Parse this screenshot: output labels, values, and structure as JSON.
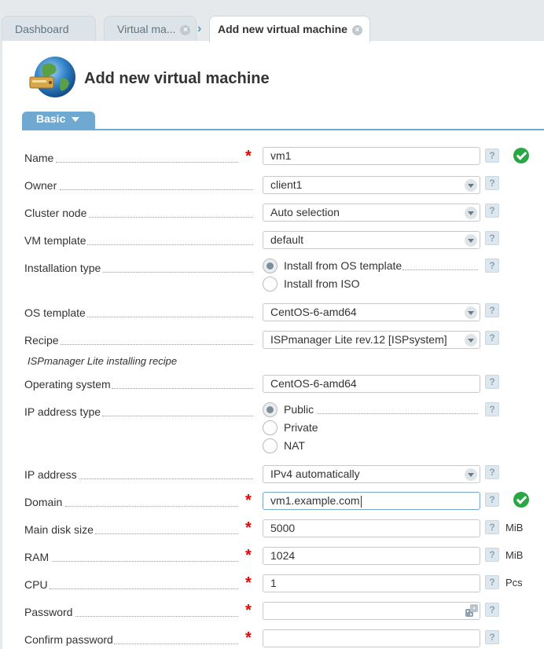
{
  "tabs": [
    {
      "label": "Dashboard"
    },
    {
      "label": "Virtual ma..."
    },
    {
      "label": "Add new virtual machine"
    }
  ],
  "page": {
    "title": "Add new virtual machine"
  },
  "form_tab": {
    "label": "Basic"
  },
  "fields": {
    "name": {
      "label": "Name",
      "value": "vm1"
    },
    "owner": {
      "label": "Owner",
      "value": "client1"
    },
    "cluster_node": {
      "label": "Cluster node",
      "value": "Auto selection"
    },
    "vm_template": {
      "label": "VM template",
      "value": "default"
    },
    "installation_type": {
      "label": "Installation type",
      "options": [
        "Install from OS template",
        "Install from ISO"
      ],
      "selected": "Install from OS template"
    },
    "os_template": {
      "label": "OS template",
      "value": "CentOS-6-amd64"
    },
    "recipe": {
      "label": "Recipe",
      "value": "ISPmanager Lite rev.12 [ISPsystem]",
      "note": "ISPmanager Lite installing recipe"
    },
    "operating_system": {
      "label": "Operating system",
      "value": "CentOS-6-amd64"
    },
    "ip_address_type": {
      "label": "IP address type",
      "options": [
        "Public",
        "Private",
        "NAT"
      ],
      "selected": "Public"
    },
    "ip_address": {
      "label": "IP address",
      "value": "IPv4 automatically"
    },
    "domain": {
      "label": "Domain",
      "value": "vm1.example.com"
    },
    "main_disk_size": {
      "label": "Main disk size",
      "value": "5000",
      "unit": "MiB"
    },
    "ram": {
      "label": "RAM",
      "value": "1024",
      "unit": "MiB"
    },
    "cpu": {
      "label": "CPU",
      "value": "1",
      "unit": "Pcs"
    },
    "password": {
      "label": "Password",
      "value": ""
    },
    "confirm_password": {
      "label": "Confirm password",
      "value": ""
    }
  },
  "icons": {
    "help": "?",
    "required": "*",
    "tab_close": "×",
    "breadcrumb": "›"
  },
  "colors": {
    "accent": "#6fa9d2",
    "required": "#e00000",
    "valid": "#28a745"
  }
}
